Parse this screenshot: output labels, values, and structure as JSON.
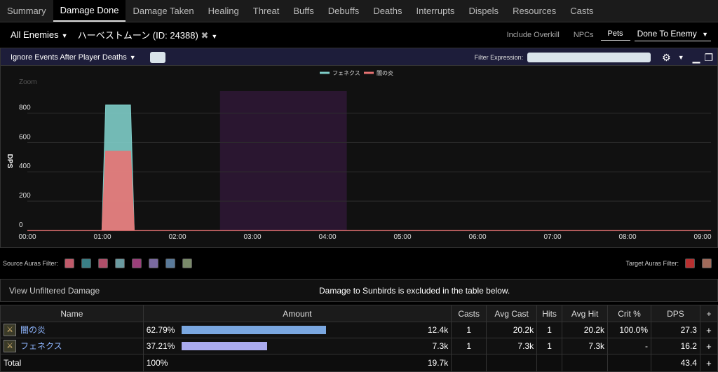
{
  "tabs": [
    "Summary",
    "Damage Done",
    "Damage Taken",
    "Healing",
    "Threat",
    "Buffs",
    "Debuffs",
    "Deaths",
    "Interrupts",
    "Dispels",
    "Resources",
    "Casts"
  ],
  "active_tab": "Damage Done",
  "filter": {
    "enemies": "All Enemies",
    "target": "ハーベストムーン (ID: 24388)",
    "options": [
      "Include Overkill",
      "NPCs",
      "Pets"
    ],
    "active_option": "Pets",
    "mode": "Done To Enemy"
  },
  "graph_header": {
    "ignore_label": "Ignore Events After Player Deaths",
    "filter_label": "Filter Expression:"
  },
  "chart_data": {
    "type": "area",
    "ylabel": "DPS",
    "zoom_label": "Zoom",
    "x_ticks": [
      "00:00",
      "01:00",
      "02:00",
      "03:00",
      "04:00",
      "05:00",
      "06:00",
      "07:00",
      "08:00",
      "09:00"
    ],
    "y_ticks": [
      0,
      200,
      400,
      600,
      800
    ],
    "ylim": [
      0,
      950
    ],
    "xlim_seconds": [
      0,
      550
    ],
    "highlight_range_seconds": [
      155,
      257
    ],
    "series": [
      {
        "name": "フェネクス",
        "color": "#7ecdc8",
        "points": [
          [
            0,
            0
          ],
          [
            60,
            0
          ],
          [
            63,
            855
          ],
          [
            83,
            855
          ],
          [
            86,
            0
          ],
          [
            550,
            0
          ]
        ]
      },
      {
        "name": "闇の炎",
        "color": "#e87474",
        "points": [
          [
            0,
            0
          ],
          [
            60,
            0
          ],
          [
            63,
            540
          ],
          [
            83,
            540
          ],
          [
            86,
            0
          ],
          [
            550,
            0
          ]
        ]
      }
    ]
  },
  "auras": {
    "source_label": "Source Auras Filter:",
    "target_label": "Target Auras Filter:",
    "source_colors": [
      "#c05a6a",
      "#3a7f86",
      "#b04f6a",
      "#6a9aa0",
      "#9a3f7a",
      "#7a6aa0",
      "#5a7a9a",
      "#7a8a6a"
    ],
    "target_colors": [
      "#b83030",
      "#a06a5a"
    ]
  },
  "info": {
    "view_unfiltered": "View Unfiltered Damage",
    "message": "Damage to Sunbirds is excluded in the table below."
  },
  "table": {
    "headers": [
      "Name",
      "Amount",
      "Casts",
      "Avg Cast",
      "Hits",
      "Avg Hit",
      "Crit %",
      "DPS",
      "+"
    ],
    "rows": [
      {
        "name": "闇の炎",
        "pct": "62.79%",
        "fraction": 0.6279,
        "bar_color": "#7aa7e0",
        "amount": "12.4k",
        "casts": "1",
        "avg_cast": "20.2k",
        "hits": "1",
        "avg_hit": "20.2k",
        "crit": "100.0%",
        "dps": "27.3",
        "plus": "+"
      },
      {
        "name": "フェネクス",
        "pct": "37.21%",
        "fraction": 0.3721,
        "bar_color": "#aaaaee",
        "amount": "7.3k",
        "casts": "1",
        "avg_cast": "7.3k",
        "hits": "1",
        "avg_hit": "7.3k",
        "crit": "-",
        "dps": "16.2",
        "plus": "+"
      }
    ],
    "total": {
      "label": "Total",
      "pct": "100%",
      "amount": "19.7k",
      "dps": "43.4",
      "plus": "+"
    }
  }
}
